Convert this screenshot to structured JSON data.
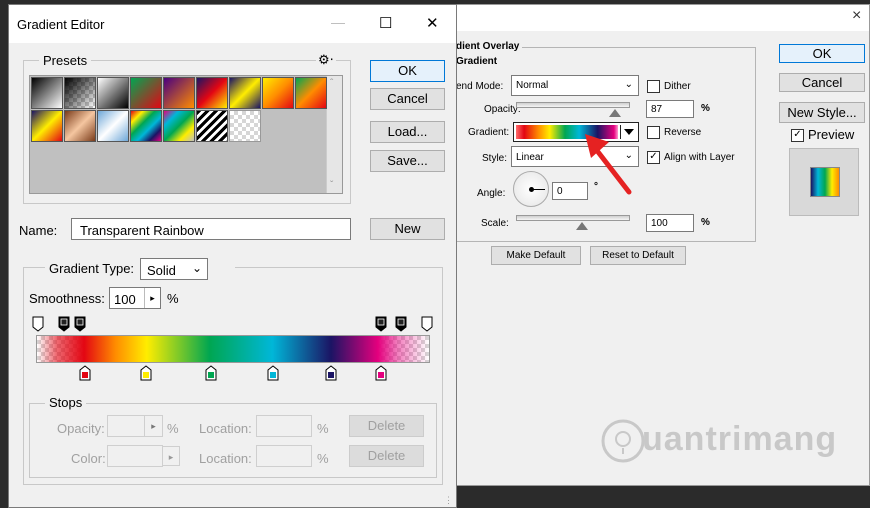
{
  "layer_style": {
    "close_glyph": "×",
    "section_title": "dient Overlay",
    "subsection_title": "Gradient",
    "blend_mode_label": "end Mode:",
    "blend_mode_value": "Normal",
    "dither_label": "Dither",
    "opacity_label": "Opacity:",
    "opacity_value": "87",
    "opacity_unit": "%",
    "opacity_fraction": 0.87,
    "gradient_label": "Gradient:",
    "reverse_label": "Reverse",
    "style_label": "Style:",
    "style_value": "Linear",
    "align_label": "Align with Layer",
    "angle_label": "Angle:",
    "angle_value": "0",
    "angle_unit": "°",
    "scale_label": "Scale:",
    "scale_value": "100",
    "scale_unit": "%",
    "make_default_label": "Make Default",
    "reset_default_label": "Reset to Default",
    "ok_label": "OK",
    "cancel_label": "Cancel",
    "new_style_label": "New Style...",
    "preview_label": "Preview"
  },
  "gradient_editor": {
    "title": "Gradient Editor",
    "minimize_glyph": "—",
    "maximize_glyph": "☐",
    "close_glyph": "✕",
    "presets_label": "Presets",
    "gear_glyph": "⚙",
    "ok_label": "OK",
    "cancel_label": "Cancel",
    "load_label": "Load...",
    "save_label": "Save...",
    "name_label": "Name:",
    "name_value": "Transparent Rainbow",
    "new_label": "New",
    "gradient_type_label": "Gradient Type:",
    "gradient_type_value": "Solid",
    "smoothness_label": "Smoothness:",
    "smoothness_value": "100",
    "smoothness_unit": "%",
    "stops_label": "Stops",
    "opacity_label": "Opacity:",
    "opacity_unit": "%",
    "location_label": "Location:",
    "location_unit": "%",
    "delete_label": "Delete",
    "color_label": "Color:",
    "color_stops": [
      "#e30613",
      "#ffed00",
      "#00a651",
      "#00b7d8",
      "#1b1464",
      "#e5007e"
    ]
  },
  "watermark": {
    "text": "uantrimang"
  }
}
